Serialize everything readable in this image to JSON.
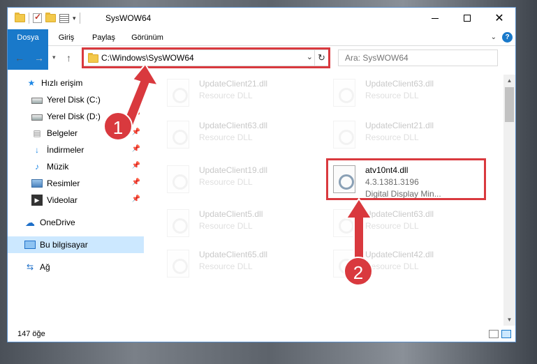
{
  "window": {
    "title": "SysWOW64"
  },
  "ribbon": {
    "tabs": [
      "Dosya",
      "Giriş",
      "Paylaş",
      "Görünüm"
    ]
  },
  "address": {
    "path": "C:\\Windows\\SysWOW64"
  },
  "search": {
    "placeholder": "Ara: SysWOW64"
  },
  "sidebar": {
    "items": [
      {
        "label": "Hızlı erişim",
        "icon": "star-icon"
      },
      {
        "label": "Yerel Disk (C:)",
        "icon": "disk-icon",
        "pinned": true
      },
      {
        "label": "Yerel Disk (D:)",
        "icon": "disk-icon",
        "pinned": true
      },
      {
        "label": "Belgeler",
        "icon": "documents-icon",
        "pinned": true
      },
      {
        "label": "İndirmeler",
        "icon": "download-icon",
        "pinned": true
      },
      {
        "label": "Müzik",
        "icon": "music-icon",
        "pinned": true
      },
      {
        "label": "Resimler",
        "icon": "pictures-icon",
        "pinned": true
      },
      {
        "label": "Videolar",
        "icon": "videos-icon",
        "pinned": true
      },
      {
        "label": "OneDrive",
        "icon": "cloud-icon"
      },
      {
        "label": "Bu bilgisayar",
        "icon": "computer-icon",
        "selected": true
      },
      {
        "label": "Ağ",
        "icon": "network-icon"
      }
    ]
  },
  "files": {
    "left": [
      {
        "name": "UpdateClient21.dll",
        "desc": "Resource DLL"
      },
      {
        "name": "UpdateClient63.dll",
        "desc": "Resource DLL"
      },
      {
        "name": "UpdateClient19.dll",
        "desc": "Resource DLL"
      },
      {
        "name": "UpdateClient5.dll",
        "desc": "Resource DLL"
      },
      {
        "name": "UpdateClient65.dll",
        "desc": "Resource DLL"
      }
    ],
    "right": [
      {
        "name": "UpdateClient63.dll",
        "desc": "Resource DLL"
      },
      {
        "name": "UpdateClient21.dll",
        "desc": "Resource DLL"
      },
      {
        "name": "atv10nt4.dll",
        "version": "4.3.1381.3196",
        "desc": "Digital Display Min..."
      },
      {
        "name": "UpdateClient63.dll",
        "desc": "Resource DLL"
      },
      {
        "name": "UpdateClient42.dll",
        "desc": "Resource DLL"
      }
    ]
  },
  "status": {
    "count": "147 öğe"
  },
  "annotations": {
    "badge1": "1",
    "badge2": "2",
    "color": "#d9393e"
  },
  "colors": {
    "accent": "#1979ca",
    "selected": "#cce8ff"
  }
}
